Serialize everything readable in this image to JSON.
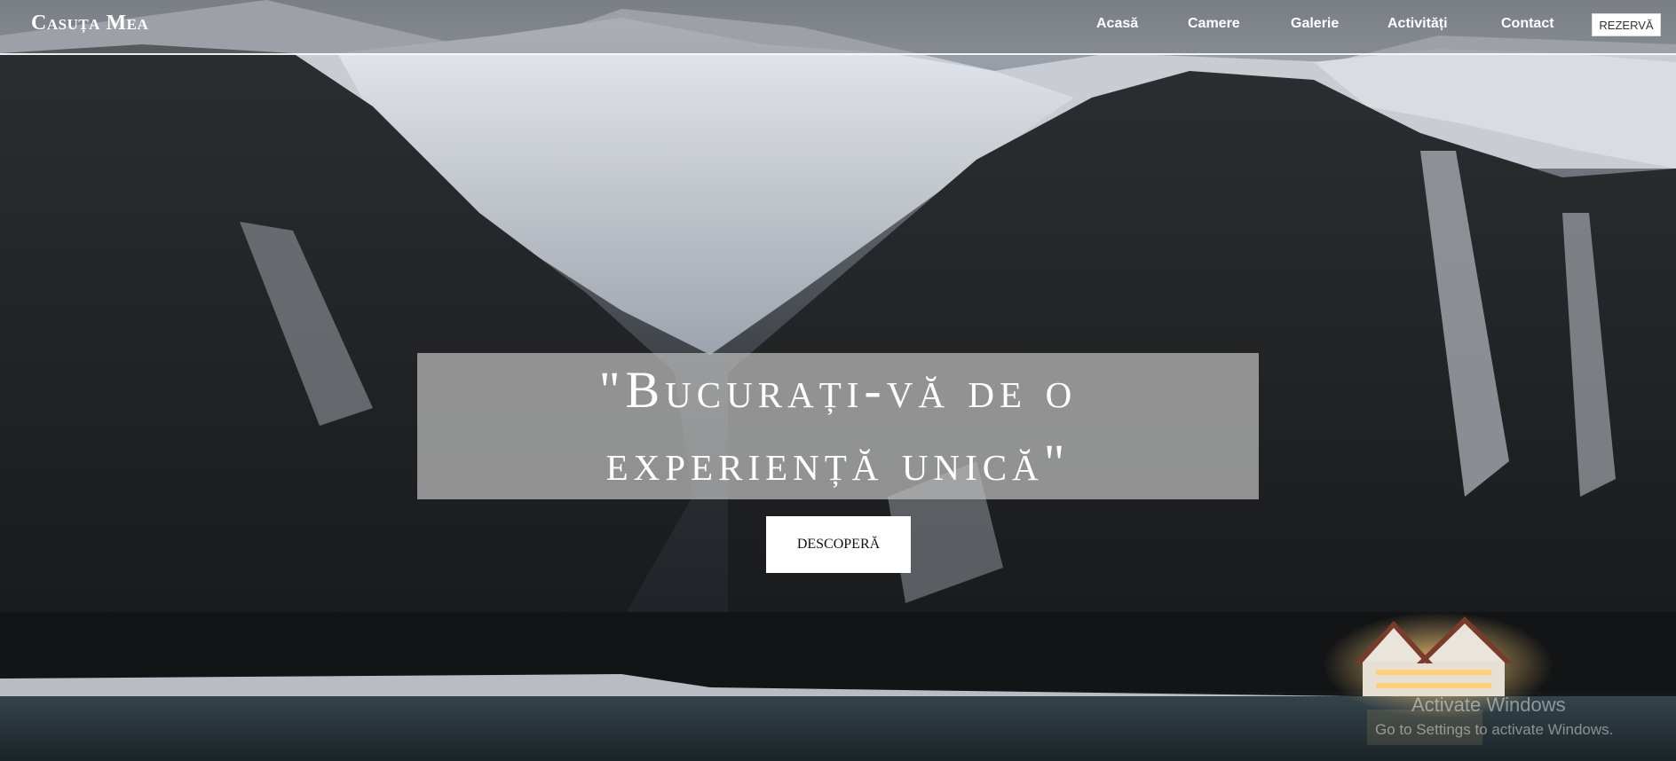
{
  "header": {
    "brand": "Casuța Mea",
    "nav": [
      "Acasă",
      "Camere",
      "Galerie",
      "Activități",
      "Contact"
    ],
    "reserve_label": "REZERVĂ"
  },
  "hero": {
    "title": "\"Bucurați-vă de o experiență unică\"",
    "cta_label": "DESCOPERĂ"
  },
  "watermark": {
    "title": "Activate Windows",
    "subtitle": "Go to Settings to activate Windows."
  }
}
